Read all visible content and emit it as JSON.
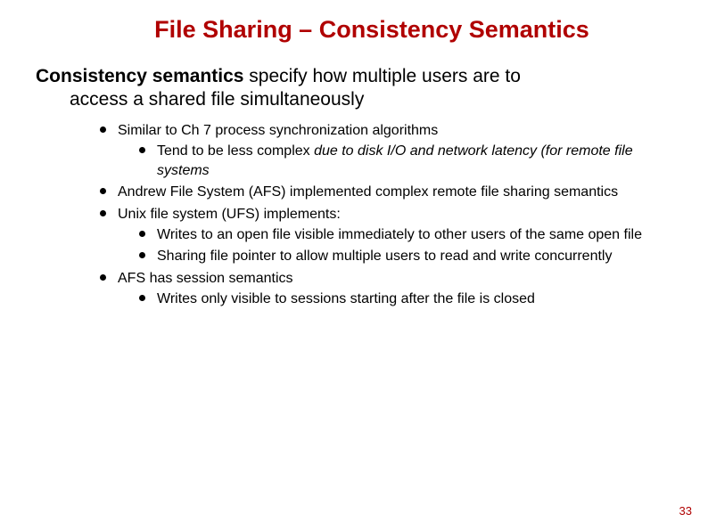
{
  "title": "File Sharing – Consistency Semantics",
  "intro": {
    "bold": "Consistency semantics",
    "rest1": " specify how multiple users are to",
    "rest2": "access a shared file simultaneously"
  },
  "bullets": [
    {
      "text": "Similar to Ch 7 process synchronization algorithms",
      "sub": [
        {
          "prefix": "Tend to be less complex ",
          "italic": "due to disk I/O and network latency (for remote file systems"
        }
      ]
    },
    {
      "text": "Andrew File System (AFS) implemented complex remote file sharing semantics",
      "sub": []
    },
    {
      "text": "Unix file system (UFS) implements:",
      "sub": [
        {
          "text": "Writes to an open file visible immediately to other users of the same open file"
        },
        {
          "text": "Sharing file pointer to allow multiple users to read and write concurrently"
        }
      ]
    },
    {
      "text": "AFS has session semantics",
      "sub": [
        {
          "text": "Writes only visible to sessions starting after the file is closed"
        }
      ]
    }
  ],
  "pageNumber": "33"
}
